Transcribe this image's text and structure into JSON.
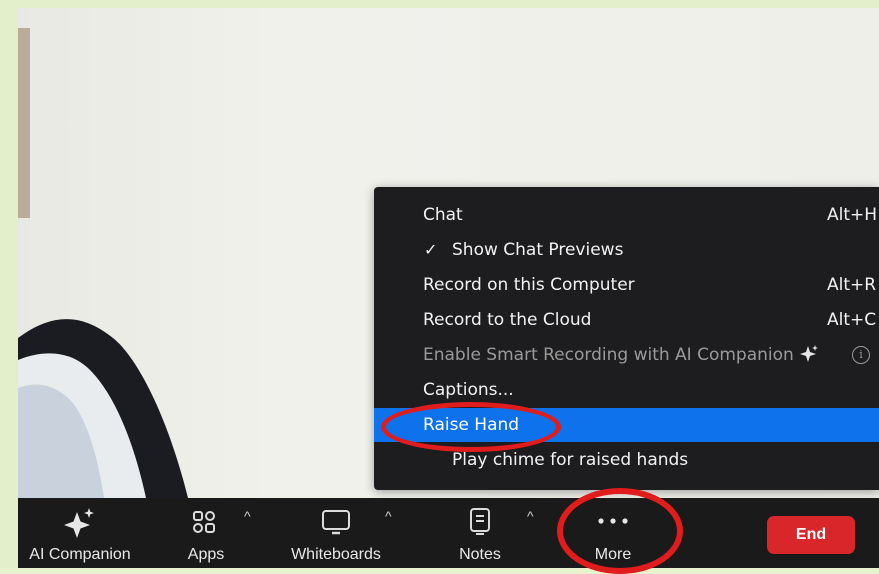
{
  "menu": {
    "items": [
      {
        "label": "Chat",
        "shortcut": "Alt+H",
        "checked": false,
        "state": "normal"
      },
      {
        "label": "Show Chat Previews",
        "shortcut": "",
        "checked": true,
        "state": "normal"
      },
      {
        "label": "Record on this Computer",
        "shortcut": "Alt+R",
        "checked": false,
        "state": "normal"
      },
      {
        "label": "Record to the Cloud",
        "shortcut": "Alt+C",
        "checked": false,
        "state": "normal"
      },
      {
        "label": "Enable Smart Recording with AI Companion",
        "shortcut": "",
        "checked": false,
        "state": "disabled"
      },
      {
        "label": "Captions...",
        "shortcut": "",
        "checked": false,
        "state": "normal"
      },
      {
        "label": "Raise Hand",
        "shortcut": "",
        "checked": false,
        "state": "selected"
      },
      {
        "label": "Play chime for raised hands",
        "shortcut": "",
        "checked": false,
        "state": "normal"
      }
    ],
    "check_glyph": "✓",
    "info_glyph": "i"
  },
  "toolbar": {
    "ai_companion": {
      "label": "AI Companion",
      "icon": "sparkle-icon"
    },
    "apps": {
      "label": "Apps",
      "icon": "apps-icon"
    },
    "whiteboards": {
      "label": "Whiteboards",
      "icon": "whiteboard-icon"
    },
    "notes": {
      "label": "Notes",
      "icon": "notes-icon"
    },
    "more": {
      "label": "More",
      "icon": "more-icon"
    },
    "end": {
      "label": "End"
    },
    "caret_glyph": "^"
  },
  "colors": {
    "highlight": "#0e72ed",
    "end_button": "#d9262a",
    "annotation": "#e01c1c",
    "menu_bg": "#1d1d1f",
    "toolbar_bg": "#1a1a1a"
  }
}
